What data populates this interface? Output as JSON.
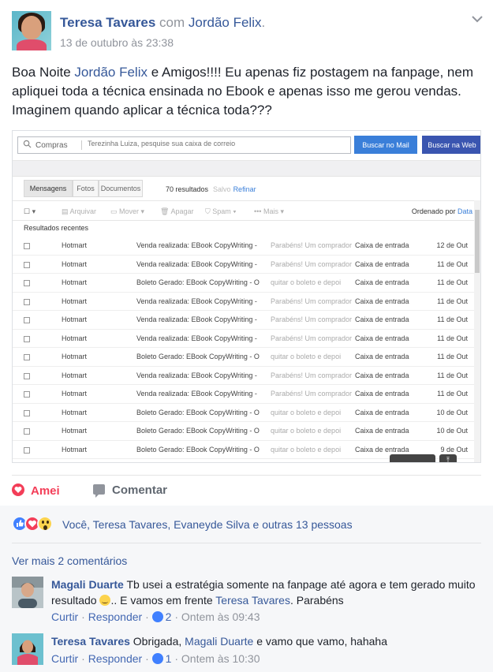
{
  "post": {
    "author": "Teresa Tavares",
    "with_word": "com",
    "tagged": "Jordão Felix",
    "tagged_suffix": ".",
    "timestamp": "13 de outubro às 23:38",
    "text_1": "Boa Noite ",
    "mention": "Jordão Felix",
    "text_2": " e Amigos!!!! Eu apenas fiz postagem na fanpage, nem apliquei toda a técnica ensinada no Ebook e apenas isso me gerou vendas. Imaginem quando aplicar a técnica toda???"
  },
  "screenshot": {
    "search_scope": "Compras",
    "search_placeholder": "Terezinha Luiza, pesquise sua caixa de correio",
    "btn_mail": "Buscar no Mail",
    "btn_web": "Buscar na Web",
    "tabs": [
      "Mensagens",
      "Fotos",
      "Documentos"
    ],
    "results_count": "70 resultados",
    "save_label": "Salvo",
    "refine_label": "Refinar",
    "toolbar": [
      "Arquivar",
      "Mover",
      "Apagar",
      "Spam",
      "Mais"
    ],
    "sort_label": "Ordenado por",
    "sort_value": "Data",
    "recent_label": "Resultados recentes",
    "rows": [
      {
        "from": "Hotmart",
        "subject": "Venda realizada: EBook CopyWriting -",
        "snippet": "Parabéns! Um comprador",
        "folder": "Caixa de entrada",
        "date": "12 de Out"
      },
      {
        "from": "Hotmart",
        "subject": "Venda realizada: EBook CopyWriting -",
        "snippet": "Parabéns! Um comprador",
        "folder": "Caixa de entrada",
        "date": "11 de Out"
      },
      {
        "from": "Hotmart",
        "subject": "Boleto Gerado: EBook CopyWriting - O",
        "snippet": "quitar o boleto e depoi",
        "folder": "Caixa de entrada",
        "date": "11 de Out"
      },
      {
        "from": "Hotmart",
        "subject": "Venda realizada: EBook CopyWriting -",
        "snippet": "Parabéns! Um comprador",
        "folder": "Caixa de entrada",
        "date": "11 de Out"
      },
      {
        "from": "Hotmart",
        "subject": "Venda realizada: EBook CopyWriting -",
        "snippet": "Parabéns! Um comprador",
        "folder": "Caixa de entrada",
        "date": "11 de Out"
      },
      {
        "from": "Hotmart",
        "subject": "Venda realizada: EBook CopyWriting -",
        "snippet": "Parabéns! Um comprador",
        "folder": "Caixa de entrada",
        "date": "11 de Out"
      },
      {
        "from": "Hotmart",
        "subject": "Boleto Gerado: EBook CopyWriting - O",
        "snippet": "quitar o boleto e depoi",
        "folder": "Caixa de entrada",
        "date": "11 de Out"
      },
      {
        "from": "Hotmart",
        "subject": "Venda realizada: EBook CopyWriting -",
        "snippet": "Parabéns! Um comprador",
        "folder": "Caixa de entrada",
        "date": "11 de Out"
      },
      {
        "from": "Hotmart",
        "subject": "Venda realizada: EBook CopyWriting -",
        "snippet": "Parabéns! Um comprador",
        "folder": "Caixa de entrada",
        "date": "11 de Out"
      },
      {
        "from": "Hotmart",
        "subject": "Boleto Gerado: EBook CopyWriting - O",
        "snippet": "quitar o boleto e depoi",
        "folder": "Caixa de entrada",
        "date": "10 de Out"
      },
      {
        "from": "Hotmart",
        "subject": "Boleto Gerado: EBook CopyWriting - O",
        "snippet": "quitar o boleto e depoi",
        "folder": "Caixa de entrada",
        "date": "10 de Out"
      },
      {
        "from": "Hotmart",
        "subject": "Boleto Gerado: EBook CopyWriting - O",
        "snippet": "quitar o boleto e depoi",
        "folder": "Caixa de entrada",
        "date": "9 de Out"
      }
    ]
  },
  "actions": {
    "love_label": "Amei",
    "comment_label": "Comentar"
  },
  "reactions": {
    "summary": "Você, Teresa Tavares, Evaneyde Silva e outras 13 pessoas",
    "icons": [
      "like-icon",
      "love-icon",
      "wow-icon"
    ]
  },
  "more_comments": "Ver mais 2 comentários",
  "comments": [
    {
      "author": "Magali Duarte",
      "text_1": " Tb usei a estratégia somente na fanpage até agora e tem gerado muito resultado ",
      "text_2": ".. E vamos em frente ",
      "mention": "Teresa Tavares",
      "text_3": ". Parabéns",
      "like": "Curtir",
      "reply": "Responder",
      "likes": "2",
      "time": "Ontem às 09:43"
    },
    {
      "author": "Teresa Tavares",
      "text_1": " Obrigada, ",
      "mention": "Magali Duarte",
      "text_2": " e vamo que vamo, hahaha",
      "like": "Curtir",
      "reply": "Responder",
      "likes": "1",
      "time": "Ontem às 10:30"
    }
  ],
  "colors": {
    "link": "#365899",
    "love": "#f33e58",
    "like": "#4080ff",
    "muted": "#90949c"
  }
}
